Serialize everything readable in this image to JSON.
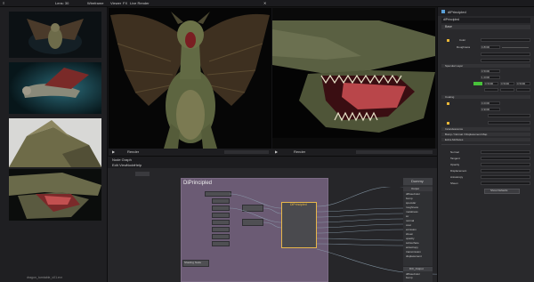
{
  "topbar": {
    "left_label": "Lens: 30",
    "left_label2": "Wireframe",
    "viewer_menu": [
      "Viewer",
      "FX",
      "Live Render"
    ]
  },
  "left_panel": {
    "footer": "dragon_turntable_v01.exr",
    "thumbnails": [
      "dragon-front-dark",
      "dragon-side-teal",
      "dragon-wing-closeup",
      "dragon-mouth-open"
    ]
  },
  "viewers": {
    "left_bar_label": "Render",
    "right_bar_label": "Render"
  },
  "node_graph": {
    "title": "Node Graph",
    "menu": [
      "Edit",
      "View",
      "Node",
      "Help"
    ],
    "group_label": "DiPrincipled",
    "selected_node": "DiPrincipled",
    "mini_node_left": "Shading Node",
    "output_node": "Output",
    "output_title": "Dummy",
    "output_ports": [
      "diffuseColor",
      "bump",
      "specular",
      "roughness",
      "metalness",
      "ior",
      "normal",
      "coat",
      "emission",
      "sheen",
      "opacity",
      "subsurface",
      "anisotropy",
      "transmission",
      "displacement"
    ],
    "bottom_node": "DiC_Output",
    "bottom_ports": [
      "diffuseColor",
      "bump",
      "specular",
      "roughness",
      "metalness"
    ]
  },
  "inspector": {
    "header": "dlPrincipled",
    "tab": "dlPrincipled",
    "section_base": "Base",
    "field_color_label": "Color",
    "field_roughness_label": "Roughness",
    "section_coating": "Coating",
    "section_specular": "Specular Layer",
    "section_incandescence": "Incandescence",
    "section_bump": "Bump / Normal / Displacement Map",
    "section_extra": "Extra Attributes",
    "value_a": "0.8000",
    "value_b": "0.5000",
    "value_c": "1.0000",
    "value_d": "0.0000",
    "value_e": "0.9000",
    "swatch_color": "#48c23a",
    "checkbox_color": "#e8b637",
    "footer_button": "Show Defaults",
    "attr_rows": [
      "Normal",
      "Tangent",
      "Opacity",
      "Displacement",
      "Anisotropy",
      "Sheen"
    ]
  },
  "colors": {
    "accent": "#e8b637",
    "group_bg": "#6b5b74"
  }
}
